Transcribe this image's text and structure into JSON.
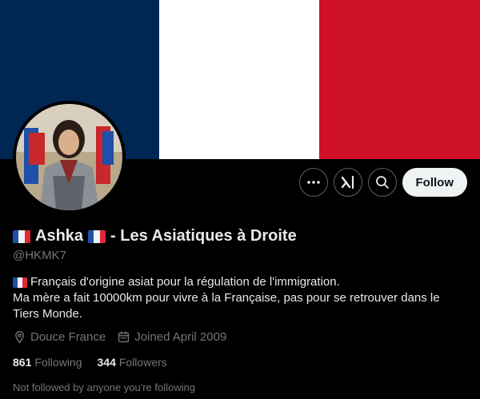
{
  "banner": {
    "colors": [
      "#002654",
      "#ffffff",
      "#ce1126"
    ]
  },
  "avatar": {
    "icon": "profile-avatar"
  },
  "actions": {
    "more_icon": "more-icon",
    "grok_icon": "grok-icon",
    "search_icon": "search-icon",
    "follow_label": "Follow"
  },
  "profile": {
    "name_part1": "Ashka",
    "name_part2": "- Les Asiatiques à Droite",
    "handle": "@HKMK7",
    "bio_line1": "Français d'origine asiat pour la régulation de l'immigration.",
    "bio_line2": "Ma mère a fait 10000km pour vivre à la Française, pas pour se retrouver dans le Tiers Monde.",
    "location": "Douce France",
    "joined": "Joined April 2009"
  },
  "stats": {
    "following_count": "861",
    "following_label": "Following",
    "followers_count": "344",
    "followers_label": "Followers"
  },
  "footer": {
    "not_followed": "Not followed by anyone you're following"
  }
}
